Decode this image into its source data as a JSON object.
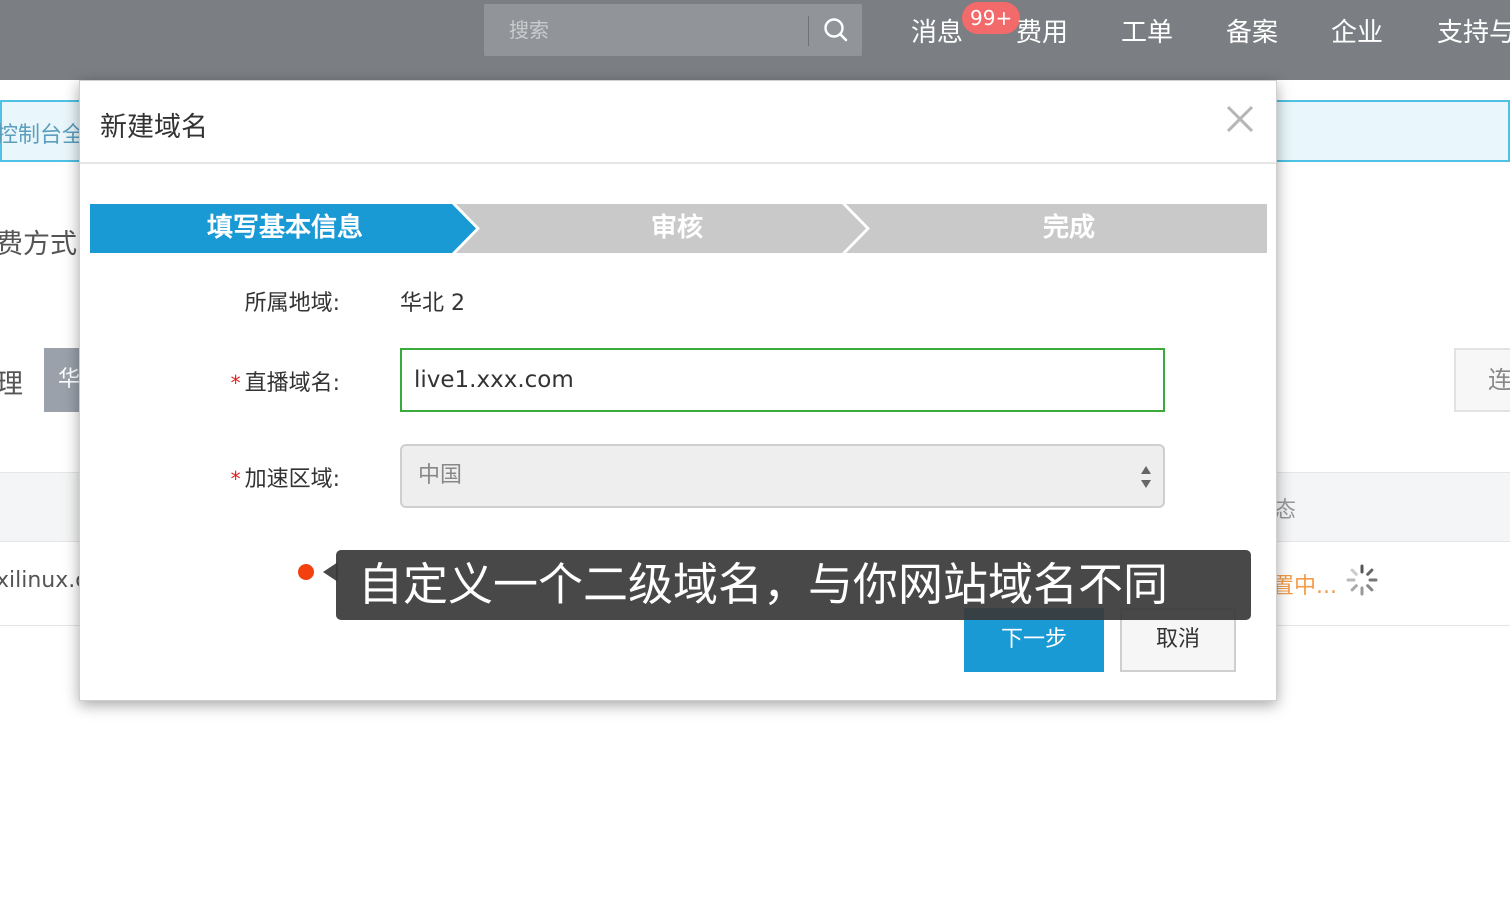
{
  "topbar": {
    "search": {
      "placeholder": "搜索"
    },
    "nav": {
      "messages": "消息",
      "messages_badge": "99+",
      "billing": "费用",
      "tickets": "工单",
      "icp": "备案",
      "enterprise": "企业",
      "support": "支持与"
    }
  },
  "background_page": {
    "notice_text": "控制台全",
    "billing_label": "费方式:",
    "manage_label": "理",
    "region_tag": "华",
    "connect_button": "连",
    "status_column": "态",
    "row_domain": "xilinux.c",
    "row_status": "置中..."
  },
  "modal": {
    "title": "新建域名",
    "steps": [
      "填写基本信息",
      "审核",
      "完成"
    ],
    "active_step": 0,
    "form": {
      "region_label": "所属地域:",
      "region_value": "华北 2",
      "domain_label": "直播域名:",
      "domain_value": "live1.xxx.com",
      "area_label": "加速区域:",
      "area_value": "中国",
      "required_mark": "*"
    },
    "buttons": {
      "next": "下一步",
      "cancel": "取消"
    }
  },
  "tooltip": {
    "text": "自定义一个二级域名，与你网站域名不同"
  },
  "colors": {
    "topbar": "#7b7f83",
    "step_active": "#1a9ad4",
    "step_inactive": "#c9c9c9",
    "input_focus_border": "#3aab3a",
    "primary_button": "#1a9ad4",
    "required": "#e02020",
    "tip_dot": "#f4400f"
  }
}
